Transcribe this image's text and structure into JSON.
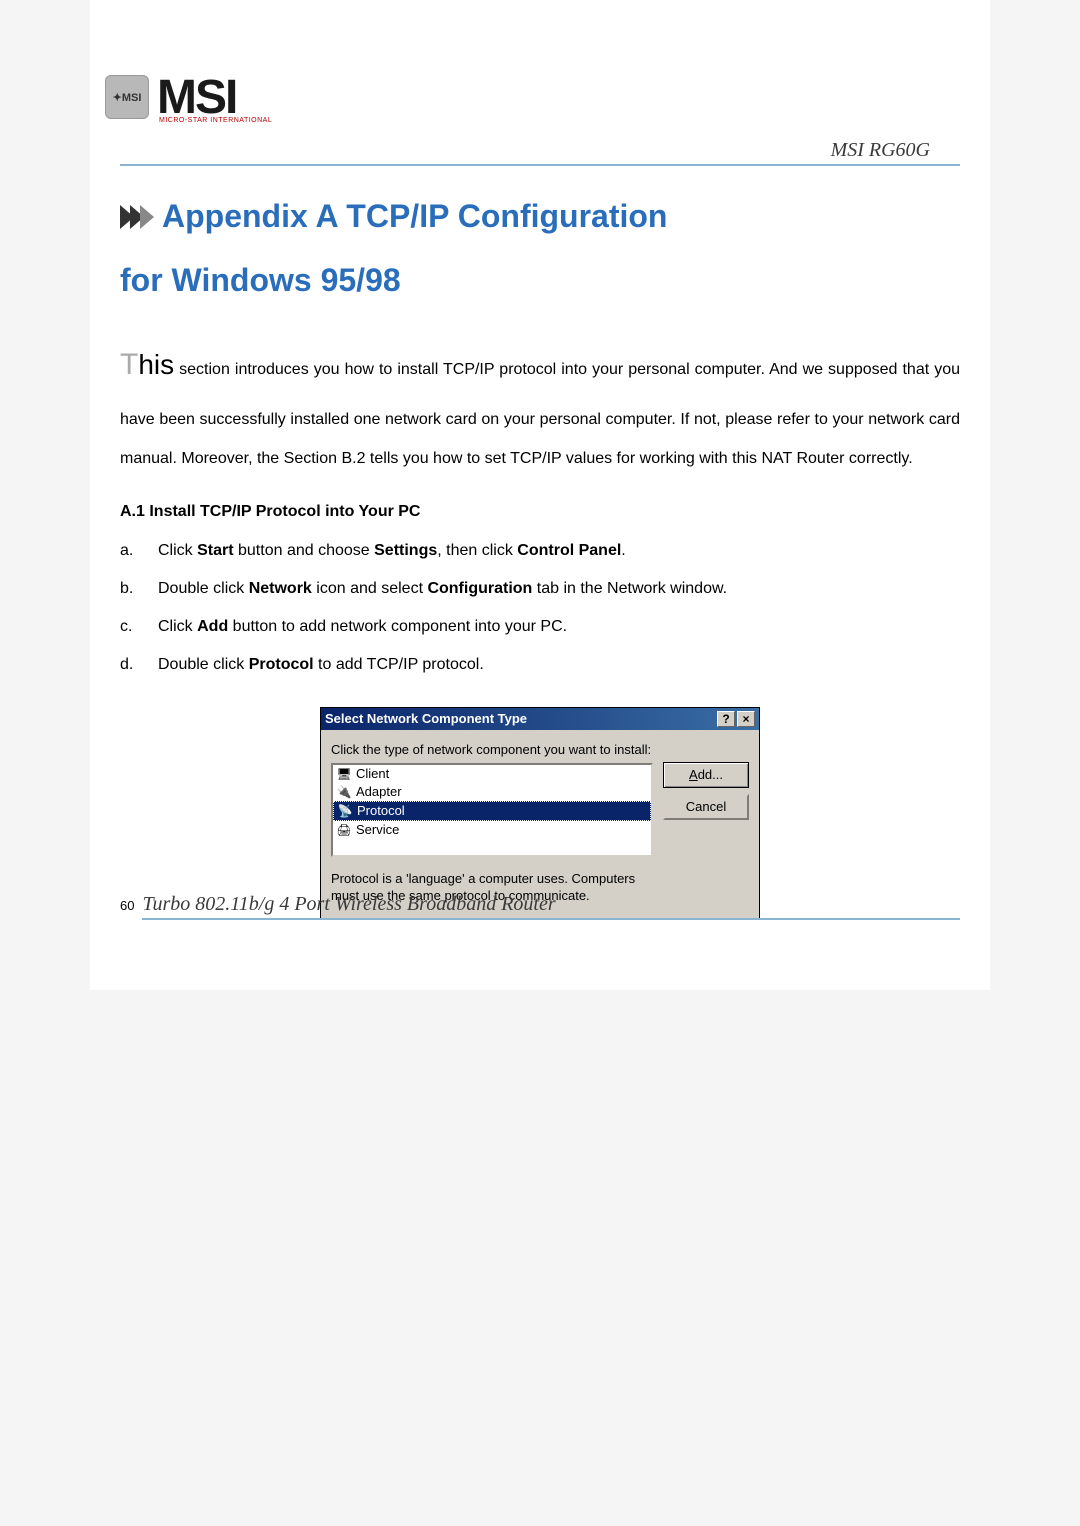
{
  "header": {
    "logo_text": "MSI",
    "logo_subtext": "MICRO-STAR INTERNATIONAL",
    "product_label": "MSI RG60G"
  },
  "title": {
    "line": "Appendix A TCP/IP Configuration",
    "line2": "for Windows 95/98"
  },
  "intro": {
    "dropcap": "T",
    "dropword": "his",
    "text": " section introduces you how to install TCP/IP protocol into your personal computer. And we supposed that you have been successfully installed one network card on your personal computer. If not, please refer to your network card manual. Moreover, the Section B.2 tells you how to set TCP/IP values for working with this NAT Router correctly."
  },
  "section_heading": "A.1 Install TCP/IP Protocol into Your PC",
  "steps": [
    {
      "marker": "a.",
      "before": "Click ",
      "b1": "Start",
      "mid1": " button and choose ",
      "b2": "Settings",
      "mid2": ", then click ",
      "b3": "Control Panel",
      "after": "."
    },
    {
      "marker": "b.",
      "before": "Double click ",
      "b1": "Network",
      "mid1": " icon and select ",
      "b2": "Configuration",
      "mid2": " tab in the Network window.",
      "b3": "",
      "after": ""
    },
    {
      "marker": "c.",
      "before": "Click ",
      "b1": "Add",
      "mid1": " button to add network component into your PC.",
      "b2": "",
      "mid2": "",
      "b3": "",
      "after": ""
    },
    {
      "marker": "d.",
      "before": "Double click ",
      "b1": "Protocol",
      "mid1": " to add TCP/IP protocol.",
      "b2": "",
      "mid2": "",
      "b3": "",
      "after": ""
    }
  ],
  "dialog": {
    "title": "Select Network Component Type",
    "help_btn": "?",
    "close_btn": "×",
    "instruction": "Click the type of network component you want to install:",
    "items": [
      {
        "icon": "🖥",
        "label": "Client"
      },
      {
        "icon": "🔌",
        "label": "Adapter"
      },
      {
        "icon": "📡",
        "label": "Protocol",
        "selected": true
      },
      {
        "icon": "🖨",
        "label": "Service"
      }
    ],
    "description": "Protocol is a 'language' a computer uses. Computers must use the same protocol to communicate.",
    "add_btn_prefix": "A",
    "add_btn_suffix": "dd...",
    "cancel_btn": "Cancel"
  },
  "footer": {
    "page_number": "60",
    "text": "Turbo 802.11b/g 4 Port Wireless Broadband Router"
  }
}
